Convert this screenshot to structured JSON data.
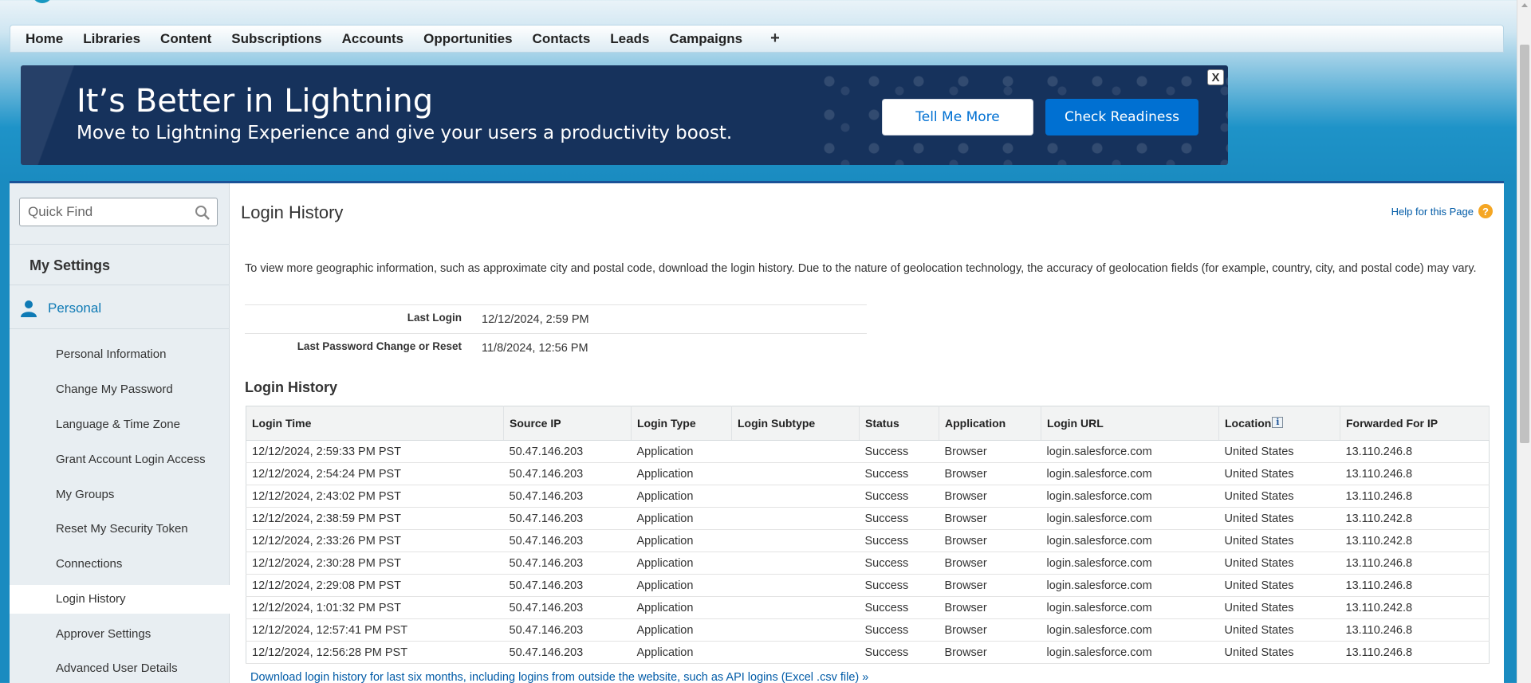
{
  "nav": {
    "tabs": [
      "Home",
      "Libraries",
      "Content",
      "Subscriptions",
      "Accounts",
      "Opportunities",
      "Contacts",
      "Leads",
      "Campaigns"
    ],
    "plus": "+"
  },
  "banner": {
    "title": "It’s Better in Lightning",
    "subtitle": "Move to Lightning Experience and give your users a productivity boost.",
    "tell_more": "Tell Me More",
    "check_readiness": "Check Readiness",
    "close": "X"
  },
  "sidebar": {
    "quick_find_placeholder": "Quick Find",
    "heading": "My Settings",
    "section": "Personal",
    "items": [
      {
        "label": "Personal Information"
      },
      {
        "label": "Change My Password"
      },
      {
        "label": "Language & Time Zone"
      },
      {
        "label": "Grant Account Login Access"
      },
      {
        "label": "My Groups"
      },
      {
        "label": "Reset My Security Token"
      },
      {
        "label": "Connections"
      },
      {
        "label": "Login History"
      },
      {
        "label": "Approver Settings"
      },
      {
        "label": "Advanced User Details"
      }
    ],
    "active_item": "Login History"
  },
  "main": {
    "title": "Login History",
    "help_label": "Help for this Page",
    "help_icon": "?",
    "info": "To view more geographic information, such as approximate city and postal code, download the login history. Due to the nature of geolocation technology, the accuracy of geolocation fields (for example, country, city, and postal code) may vary.",
    "last_login_label": "Last Login",
    "last_login_value": "12/12/2024, 2:59 PM",
    "last_pw_label": "Last Password Change or Reset",
    "last_pw_value": "11/8/2024, 12:56 PM",
    "section_title": "Login History",
    "download_link": "Download login history for last six months, including logins from outside the website, such as API logins (Excel .csv file) »"
  },
  "table": {
    "columns": [
      "Login Time",
      "Source IP",
      "Login Type",
      "Login Subtype",
      "Status",
      "Application",
      "Login URL",
      "Location",
      "Forwarded For IP"
    ],
    "location_info_icon": "i",
    "rows": [
      [
        "12/12/2024, 2:59:33 PM PST",
        "50.47.146.203",
        "Application",
        "",
        "Success",
        "Browser",
        "login.salesforce.com",
        "United States",
        "13.110.246.8"
      ],
      [
        "12/12/2024, 2:54:24 PM PST",
        "50.47.146.203",
        "Application",
        "",
        "Success",
        "Browser",
        "login.salesforce.com",
        "United States",
        "13.110.246.8"
      ],
      [
        "12/12/2024, 2:43:02 PM PST",
        "50.47.146.203",
        "Application",
        "",
        "Success",
        "Browser",
        "login.salesforce.com",
        "United States",
        "13.110.246.8"
      ],
      [
        "12/12/2024, 2:38:59 PM PST",
        "50.47.146.203",
        "Application",
        "",
        "Success",
        "Browser",
        "login.salesforce.com",
        "United States",
        "13.110.242.8"
      ],
      [
        "12/12/2024, 2:33:26 PM PST",
        "50.47.146.203",
        "Application",
        "",
        "Success",
        "Browser",
        "login.salesforce.com",
        "United States",
        "13.110.242.8"
      ],
      [
        "12/12/2024, 2:30:28 PM PST",
        "50.47.146.203",
        "Application",
        "",
        "Success",
        "Browser",
        "login.salesforce.com",
        "United States",
        "13.110.246.8"
      ],
      [
        "12/12/2024, 2:29:08 PM PST",
        "50.47.146.203",
        "Application",
        "",
        "Success",
        "Browser",
        "login.salesforce.com",
        "United States",
        "13.110.246.8"
      ],
      [
        "12/12/2024, 1:01:32 PM PST",
        "50.47.146.203",
        "Application",
        "",
        "Success",
        "Browser",
        "login.salesforce.com",
        "United States",
        "13.110.242.8"
      ],
      [
        "12/12/2024, 12:57:41 PM PST",
        "50.47.146.203",
        "Application",
        "",
        "Success",
        "Browser",
        "login.salesforce.com",
        "United States",
        "13.110.246.8"
      ],
      [
        "12/12/2024, 12:56:28 PM PST",
        "50.47.146.203",
        "Application",
        "",
        "Success",
        "Browser",
        "login.salesforce.com",
        "United States",
        "13.110.246.8"
      ]
    ]
  },
  "colors": {
    "brand_blue": "#1798c1",
    "banner_navy": "#16325c",
    "button_blue": "#0070d2",
    "link_blue": "#015ba7",
    "help_orange": "#f5a623"
  }
}
